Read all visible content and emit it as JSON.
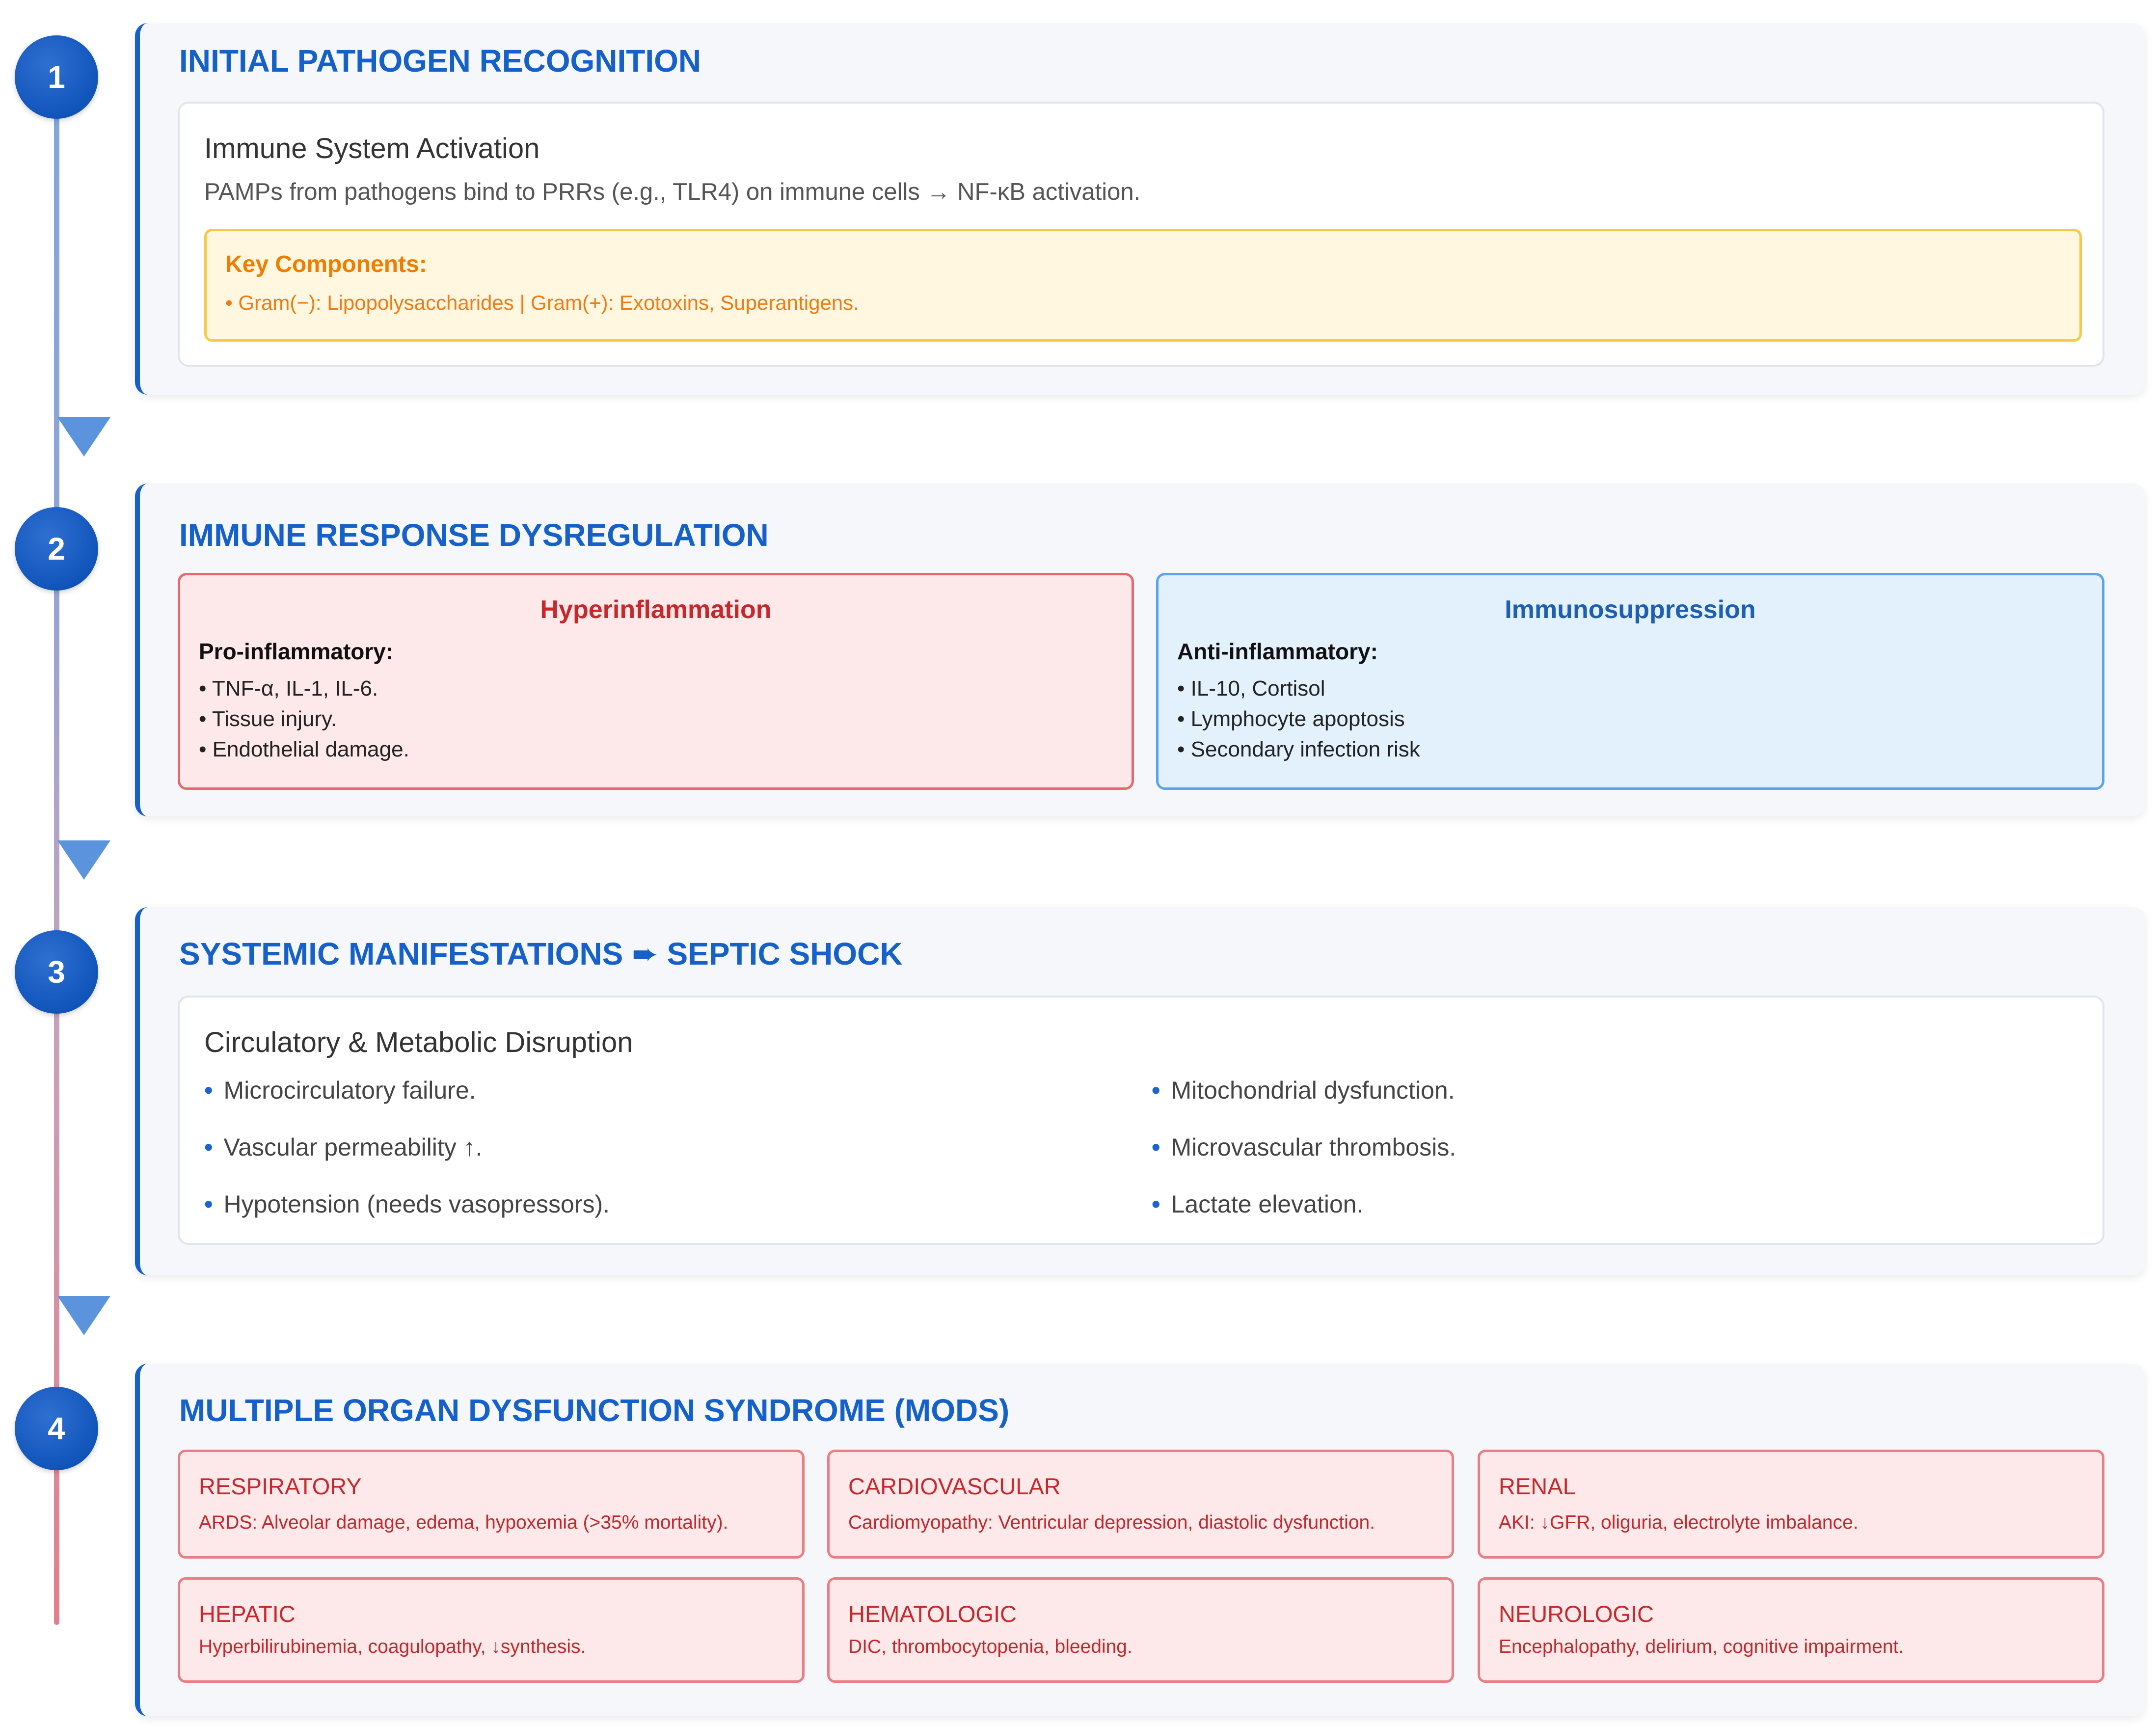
{
  "stages": [
    {
      "number": "1",
      "title": "INITIAL PATHOGEN RECOGNITION",
      "card_title": "Immune System Activation",
      "description": "PAMPs from pathogens bind to PRRs (e.g., TLR4) on immune cells → NF-κB activation.",
      "key_title": "Key Components:",
      "key_text": "• Gram(−): Lipopolysaccharides | Gram(+): Exotoxins, Superantigens."
    },
    {
      "number": "2",
      "title": "IMMUNE RESPONSE DYSREGULATION",
      "hyper": {
        "title": "Hyperinflammation",
        "subtitle": "Pro-inflammatory:",
        "items": [
          "• TNF-α, IL-1, IL-6.",
          "• Tissue injury.",
          "• Endothelial damage."
        ]
      },
      "immuno": {
        "title": "Immunosuppression",
        "subtitle": "Anti-inflammatory:",
        "items": [
          "• IL-10, Cortisol",
          "• Lymphocyte apoptosis",
          "• Secondary infection risk"
        ]
      }
    },
    {
      "number": "3",
      "title": "SYSTEMIC MANIFESTATIONS ➨ SEPTIC SHOCK",
      "card_title": "Circulatory & Metabolic Disruption",
      "bullet": "•",
      "items": [
        "Microcirculatory failure.",
        "Vascular permeability ↑.",
        "Hypotension (needs vasopressors).",
        "Mitochondrial dysfunction.",
        "Microvascular thrombosis.",
        "Lactate elevation."
      ]
    },
    {
      "number": "4",
      "title": "MULTIPLE ORGAN DYSFUNCTION SYNDROME (MODS)",
      "organs": [
        {
          "name": "RESPIRATORY",
          "desc": "ARDS: Alveolar damage, edema, hypoxemia (>35% mortality)."
        },
        {
          "name": "CARDIOVASCULAR",
          "desc": "Cardiomyopathy: Ventricular depression, diastolic dysfunction."
        },
        {
          "name": "RENAL",
          "desc": "AKI: ↓GFR, oliguria, electrolyte imbalance."
        },
        {
          "name": "HEPATIC",
          "desc": "Hyperbilirubinemia, coagulopathy, ↓synthesis."
        },
        {
          "name": "HEMATOLOGIC",
          "desc": "DIC, thrombocytopenia, bleeding."
        },
        {
          "name": "NEUROLOGIC",
          "desc": "Encephalopathy, delirium, cognitive impairment."
        }
      ]
    }
  ],
  "colors": {
    "primary_blue": "#1560c9",
    "hyper_red": "#c6282c",
    "immuno_blue": "#1f5fb0",
    "key_orange": "#f07d00"
  }
}
